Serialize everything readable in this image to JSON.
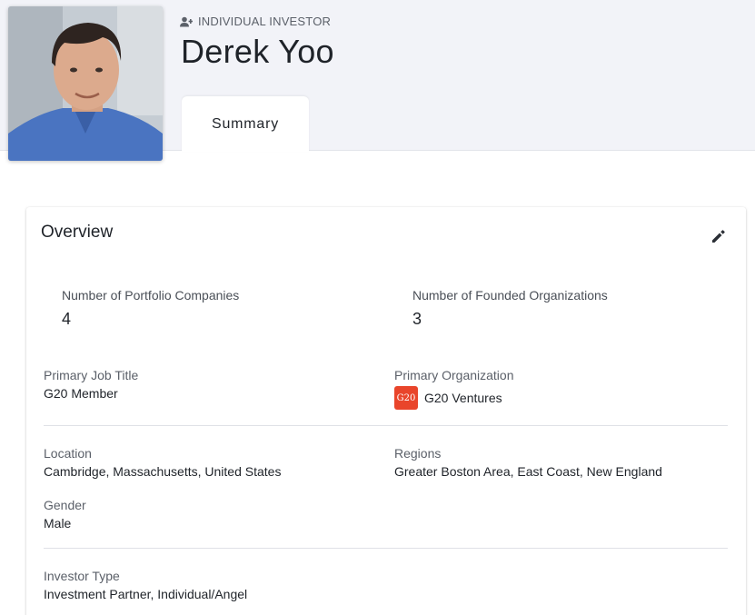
{
  "profile": {
    "type_label": "INDIVIDUAL INVESTOR",
    "name": "Derek Yoo"
  },
  "tabs": [
    {
      "label": "Summary"
    }
  ],
  "overview": {
    "title": "Overview",
    "stats": [
      {
        "label": "Number of Portfolio Companies",
        "value": "4"
      },
      {
        "label": "Number of Founded Organizations",
        "value": "3"
      }
    ],
    "primary_job_title": {
      "label": "Primary Job Title",
      "value": "G20 Member"
    },
    "primary_organization": {
      "label": "Primary Organization",
      "value": "G20 Ventures",
      "logo_text": "G20",
      "logo_color": "#e9452b"
    },
    "location": {
      "label": "Location",
      "value": "Cambridge, Massachusetts, United States"
    },
    "regions": {
      "label": "Regions",
      "value": "Greater Boston Area, East Coast, New England"
    },
    "gender": {
      "label": "Gender",
      "value": "Male"
    },
    "investor_type": {
      "label": "Investor Type",
      "value": "Investment Partner, Individual/Angel"
    }
  },
  "icons": {
    "type": "person-icon",
    "edit": "pencil-icon",
    "avatar": "profile-photo"
  }
}
